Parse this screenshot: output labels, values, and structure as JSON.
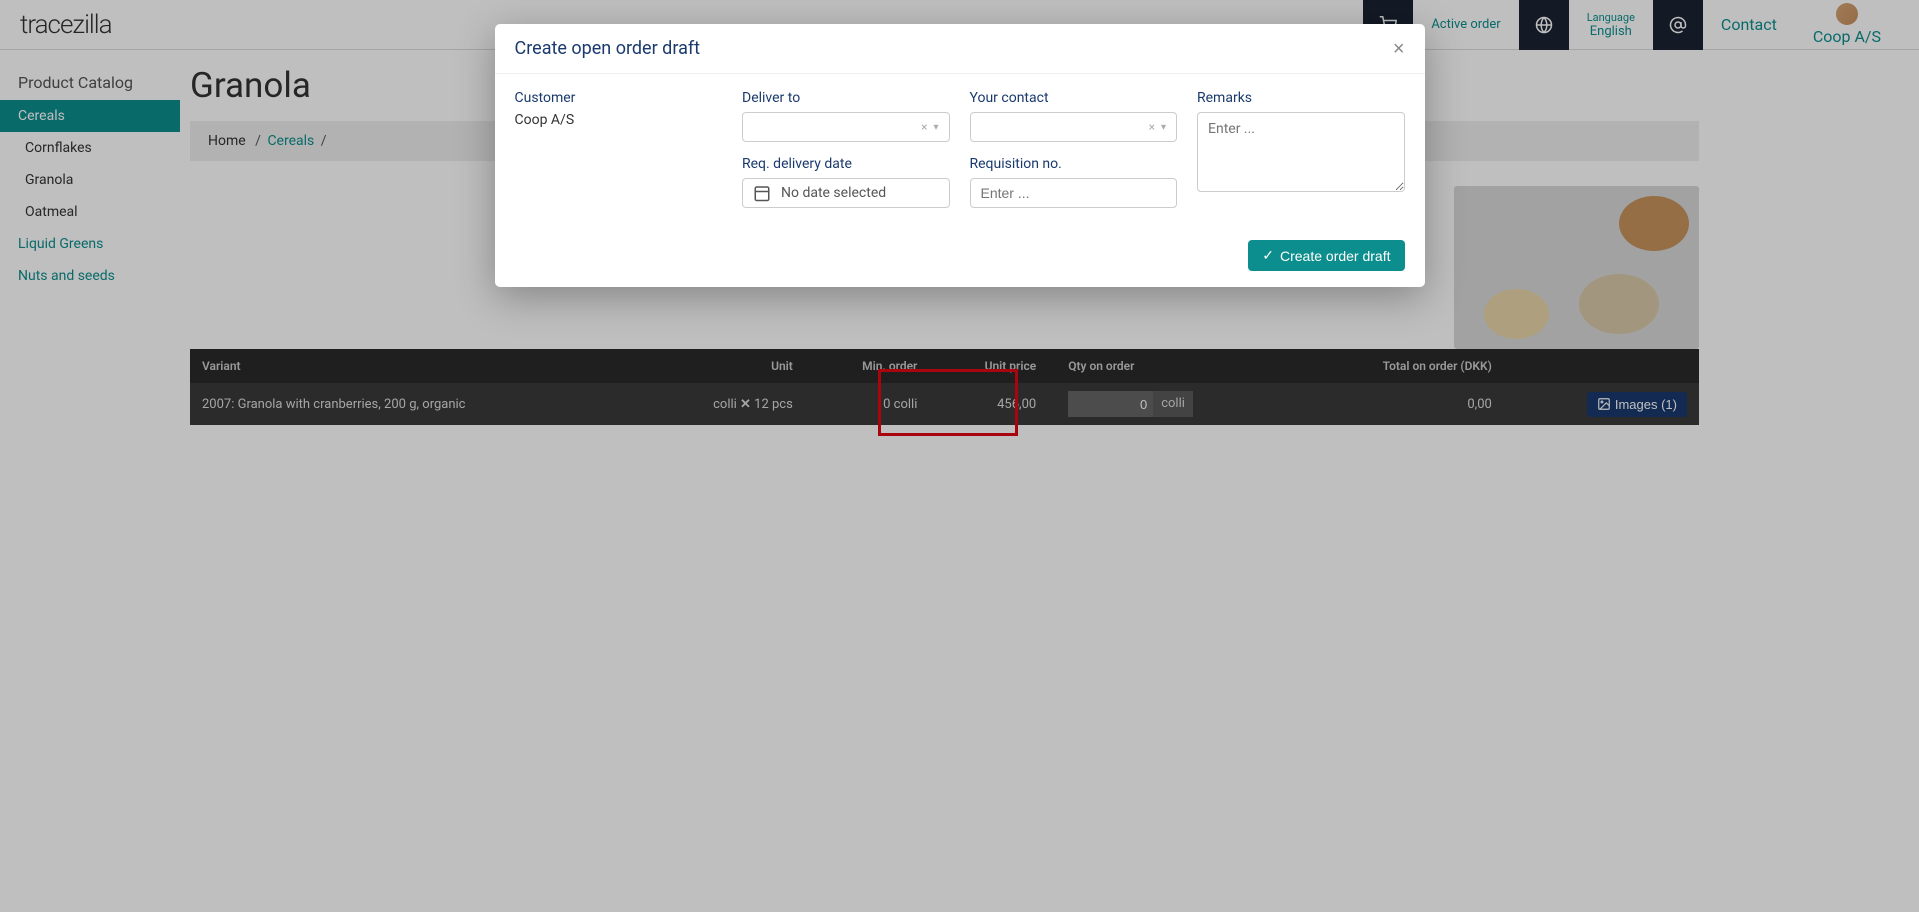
{
  "header": {
    "logo": "tracezilla",
    "active_order": "Active order",
    "language_label": "Language",
    "language_value": "English",
    "contact": "Contact",
    "company": "Coop A/S"
  },
  "sidebar": {
    "title": "Product Catalog",
    "items": [
      {
        "label": "Cereals",
        "active": true
      },
      {
        "label": "Cornflakes",
        "sub": true
      },
      {
        "label": "Granola",
        "sub": true
      },
      {
        "label": "Oatmeal",
        "sub": true
      },
      {
        "label": "Liquid Greens"
      },
      {
        "label": "Nuts and seeds"
      }
    ]
  },
  "page": {
    "title": "Granola",
    "breadcrumb": {
      "home": "Home",
      "cat": "Cereals",
      "sep": "/"
    }
  },
  "table": {
    "headers": {
      "variant": "Variant",
      "unit": "Unit",
      "min_order": "Min. order",
      "unit_price": "Unit price",
      "qty": "Qty on order",
      "total": "Total on order (DKK)"
    },
    "row": {
      "variant": "2007: Granola with cranberries, 200 g, organic",
      "unit_prefix": "colli ",
      "unit_suffix": " 12 pcs",
      "min_order": "0 colli",
      "unit_price": "456,00",
      "qty_value": "0",
      "qty_unit": "colli",
      "total": "0,00",
      "images_btn": "Images (1)"
    }
  },
  "modal": {
    "title": "Create open order draft",
    "close": "×",
    "customer_label": "Customer",
    "customer_value": "Coop A/S",
    "deliver_label": "Deliver to",
    "contact_label": "Your contact",
    "remarks_label": "Remarks",
    "remarks_placeholder": "Enter ...",
    "reqdate_label": "Req. delivery date",
    "reqdate_placeholder": "No date selected",
    "reqno_label": "Requisition no.",
    "reqno_placeholder": "Enter ...",
    "select_clear": "×",
    "select_arrow": "▾",
    "create_btn": "Create order draft"
  }
}
